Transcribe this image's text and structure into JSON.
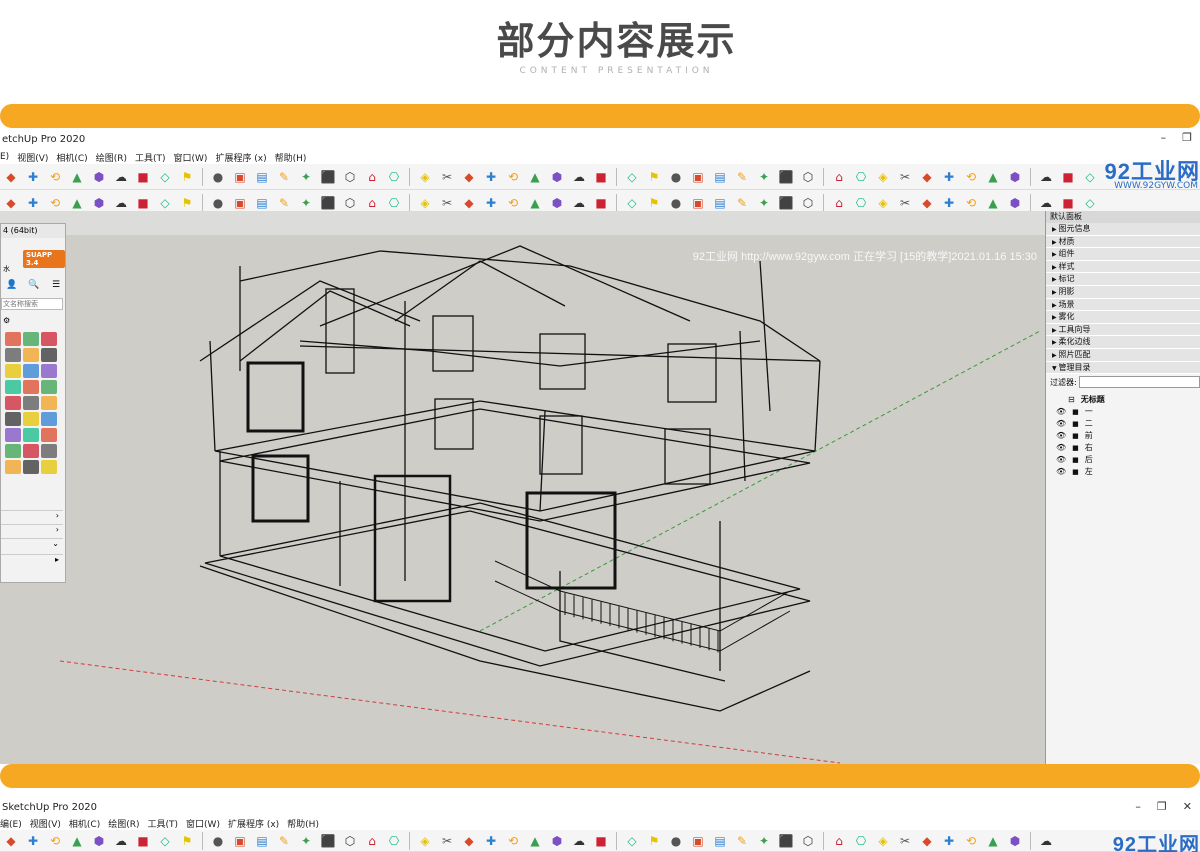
{
  "header": {
    "title": "部分内容展示",
    "subtitle": "CONTENT PRESENTATION"
  },
  "app1": {
    "window_title": "etchUp Pro 2020",
    "menu": [
      "E)",
      "视图(V)",
      "相机(C)",
      "绘图(R)",
      "工具(T)",
      "窗口(W)",
      "扩展程序 (x)",
      "帮助(H)"
    ],
    "logo_text": "92工业网",
    "logo_url": "WWW.92GYW.COM",
    "watermark": "92工业网 http://www.92gyw.com 正在学习 [15的教学]2021.01.16 15:30",
    "plugin": {
      "title": "4 (64bit)",
      "badge": "SUAPP 3.4",
      "label": "水",
      "search_placeholder": "文名称搜索"
    },
    "tray": {
      "header": "默认面板",
      "items": [
        "图元信息",
        "材质",
        "组件",
        "样式",
        "标记",
        "阴影",
        "场景",
        "雾化",
        "工具向导",
        "柔化边线",
        "照片匹配",
        "管理目录"
      ],
      "filter_label": "过滤器:",
      "outliner_root": "无标题",
      "outliner_items": [
        "一",
        "二",
        "前",
        "右",
        "后",
        "左"
      ]
    }
  },
  "app2": {
    "window_title": "SketchUp Pro 2020",
    "menu": [
      "编(E)",
      "视图(V)",
      "相机(C)",
      "绘图(R)",
      "工具(T)",
      "窗口(W)",
      "扩展程序 (x)",
      "帮助(H)"
    ],
    "logo_text": "92工业网"
  },
  "colors": {
    "accent": "#f7a823",
    "viewport_bg": "#cfcdc8",
    "logo_blue": "#2b6cc4"
  }
}
